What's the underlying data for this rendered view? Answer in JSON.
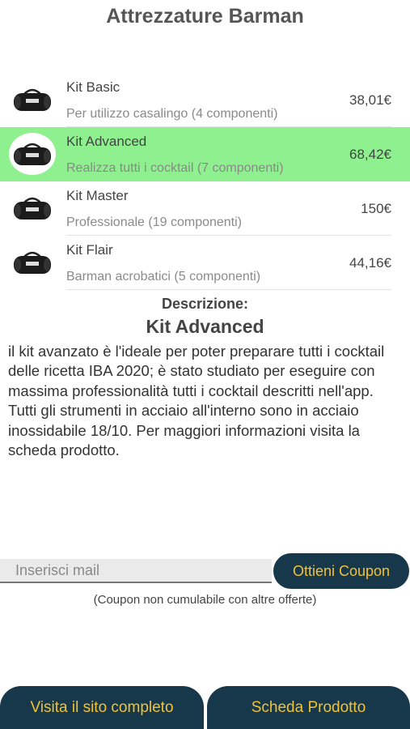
{
  "page": {
    "title": "Attrezzature Barman"
  },
  "kits": [
    {
      "name": "Kit Basic",
      "subtitle": "Per utilizzo casalingo (4 componenti)",
      "price": "38,01€",
      "selected": false
    },
    {
      "name": "Kit Advanced",
      "subtitle": "Realizza tutti i cocktail (7 componenti)",
      "price": "68,42€",
      "selected": true
    },
    {
      "name": "Kit Master",
      "subtitle": "Professionale  (19 componenti)",
      "price": "150€",
      "selected": false
    },
    {
      "name": "Kit Flair",
      "subtitle": "Barman acrobatici (5 componenti)",
      "price": "44,16€",
      "selected": false
    }
  ],
  "kit_icon": "duffel-bag-icon",
  "description": {
    "label": "Descrizione:",
    "title": "Kit Advanced",
    "text": "il kit avanzato è l'ideale per poter preparare tutti i cocktail delle ricetta IBA 2020; è stato studiato per eseguire con massima professionalità tutti i cocktail descritti nell'app. Tutti gli strumenti in acciaio all'interno sono in acciaio inossidabile 18/10. Per maggiori informazioni visita la scheda prodotto."
  },
  "coupon": {
    "placeholder": "Inserisci mail",
    "button_label": "Ottieni Coupon",
    "note": "(Coupon non cumulabile con altre offerte)"
  },
  "buttons": {
    "site_label": "Visita il sito completo",
    "sheet_label": "Scheda Prodotto"
  },
  "colors": {
    "selected_row": "#8ef08e",
    "button_bg": "#17384a",
    "button_text": "#f1c232"
  }
}
